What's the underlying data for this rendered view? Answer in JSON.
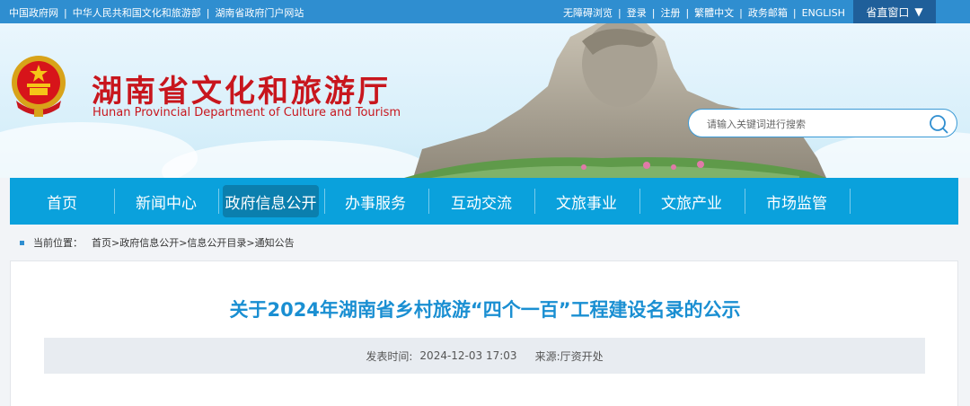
{
  "topbar": {
    "left_links": [
      "中国政府网",
      "中华人民共和国文化和旅游部",
      "湖南省政府门户网站"
    ],
    "right_links": [
      "无障碍浏览",
      "登录",
      "注册",
      "繁體中文",
      "政务邮箱",
      "ENGLISH"
    ],
    "portal_button": "省直窗口"
  },
  "header": {
    "title": "湖南省文化和旅游厅",
    "subtitle": "Hunan Provincial Department of Culture and Tourism",
    "search_placeholder": "请输入关键词进行搜索"
  },
  "nav": {
    "items": [
      "首页",
      "新闻中心",
      "政府信息公开",
      "办事服务",
      "互动交流",
      "文旅事业",
      "文旅产业",
      "市场监管"
    ],
    "active_index": 2
  },
  "breadcrumb": {
    "label": "当前位置：",
    "path": "首页>政府信息公开>信息公开目录>通知公告"
  },
  "article": {
    "title": "关于2024年湖南省乡村旅游“四个一百”工程建设名录的公示",
    "published_label": "发表时间:",
    "published_value": "2024-12-03 17:03",
    "source_label": "来源:",
    "source_value": "厅资开处"
  },
  "colors": {
    "topbar": "#2f8ed0",
    "nav": "#0aa1dc",
    "nav_active": "#0b7fae",
    "title_red": "#c8161d",
    "article_title": "#1a8fd2"
  }
}
